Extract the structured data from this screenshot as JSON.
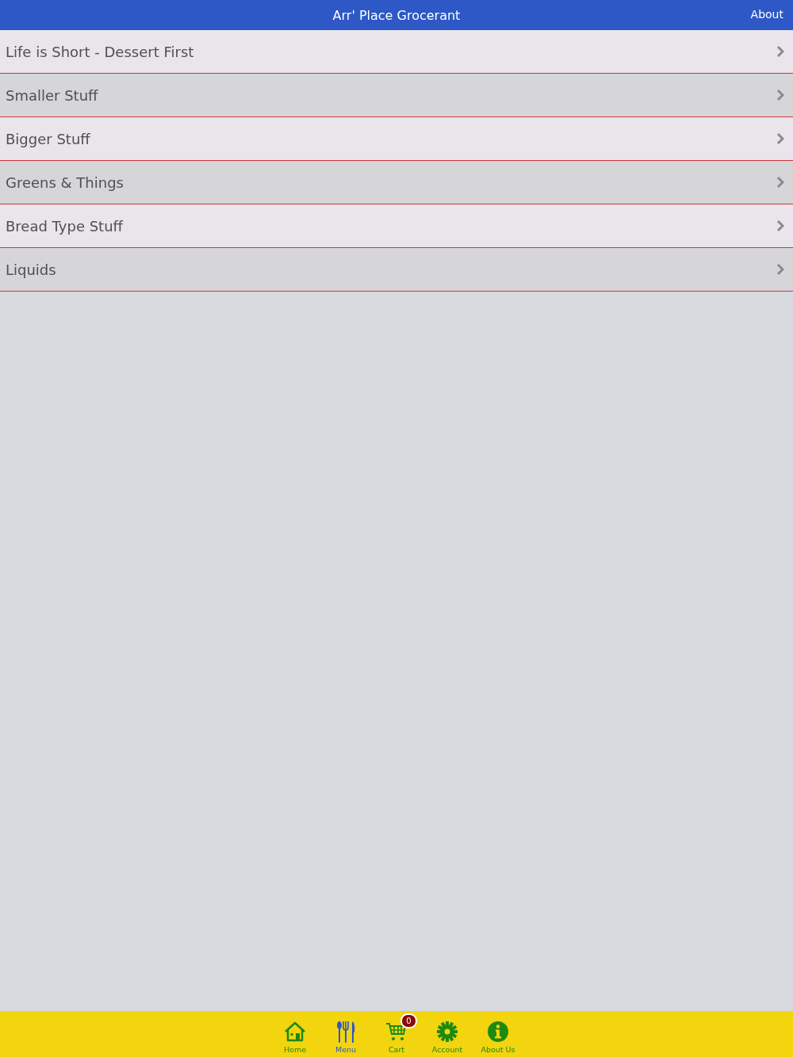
{
  "header": {
    "title": "Arr' Place Grocerant",
    "action": "About"
  },
  "categories": [
    {
      "label": "Life is Short - Dessert First"
    },
    {
      "label": "Smaller Stuff"
    },
    {
      "label": "Bigger Stuff"
    },
    {
      "label": "Greens & Things"
    },
    {
      "label": "Bread Type Stuff"
    },
    {
      "label": "Liquids"
    }
  ],
  "tab_bar": {
    "tabs": [
      {
        "kind": "home",
        "label": "Home",
        "selected": false
      },
      {
        "kind": "menu",
        "label": "Menu",
        "selected": true
      },
      {
        "kind": "cart",
        "label": "Cart",
        "selected": false,
        "badge": "0"
      },
      {
        "kind": "account",
        "label": "Account",
        "selected": false
      },
      {
        "kind": "about",
        "label": "About Us",
        "selected": false
      }
    ]
  }
}
